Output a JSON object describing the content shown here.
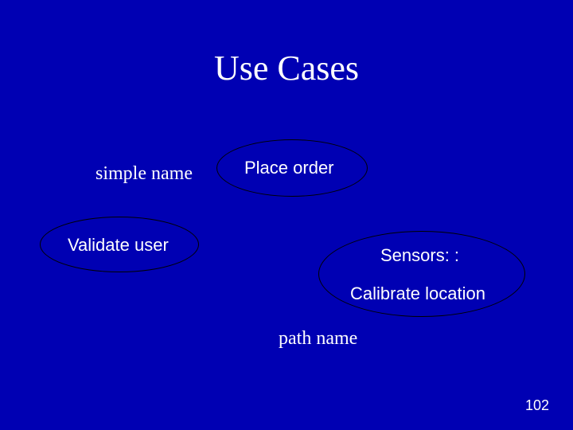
{
  "title": "Use Cases",
  "labels": {
    "simple_name": "simple name",
    "path_name": "path name"
  },
  "usecases": {
    "place_order": "Place order",
    "validate_user": "Validate user",
    "sensors_prefix": "Sensors: :",
    "calibrate_location": "Calibrate location"
  },
  "page_number": "102"
}
